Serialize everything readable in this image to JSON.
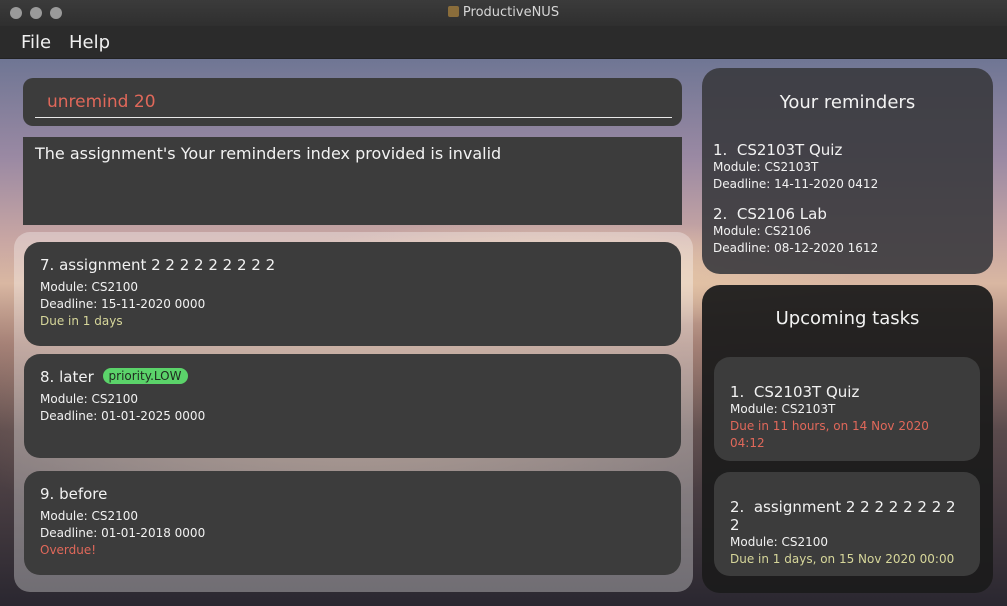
{
  "window": {
    "title": "ProductiveNUS"
  },
  "menu": {
    "file": "File",
    "help": "Help"
  },
  "command": {
    "value": "unremind 20"
  },
  "result": {
    "text": "The assignment's Your reminders index provided is invalid"
  },
  "assignments": [
    {
      "index": "7.",
      "name": "assignment 2 2 2 2 2 2 2 2 2",
      "module": "Module: CS2100",
      "deadline": "Deadline: 15-11-2020 0000",
      "status": "Due in 1 days"
    },
    {
      "index": "8.",
      "name": "later",
      "tag": "priority.LOW",
      "module": "Module: CS2100",
      "deadline": "Deadline: 01-01-2025 0000"
    },
    {
      "index": "9.",
      "name": "before",
      "module": "Module: CS2100",
      "deadline": "Deadline: 01-01-2018 0000",
      "status": "Overdue!"
    }
  ],
  "reminders": {
    "title": "Your reminders",
    "items": [
      {
        "index": "1.",
        "name": "CS2103T Quiz",
        "module": "Module: CS2103T",
        "deadline": "Deadline: 14-11-2020 0412"
      },
      {
        "index": "2.",
        "name": "CS2106 Lab",
        "module": "Module: CS2106",
        "deadline": "Deadline: 08-12-2020 1612"
      }
    ]
  },
  "upcoming": {
    "title": "Upcoming tasks",
    "items": [
      {
        "index": "1.",
        "name": "CS2103T Quiz",
        "module": "Module: CS2103T",
        "status": "Due in 11 hours, on 14 Nov 2020 04:12"
      },
      {
        "index": "2.",
        "name": "assignment 2 2 2 2 2 2 2 2 2",
        "module": "Module: CS2100",
        "status": "Due in 1 days, on 15 Nov 2020 00:00"
      }
    ]
  },
  "colors": {
    "accent_red": "#e0685a",
    "due_yellow": "#d6d69a",
    "tag_green": "#5bd36a"
  }
}
